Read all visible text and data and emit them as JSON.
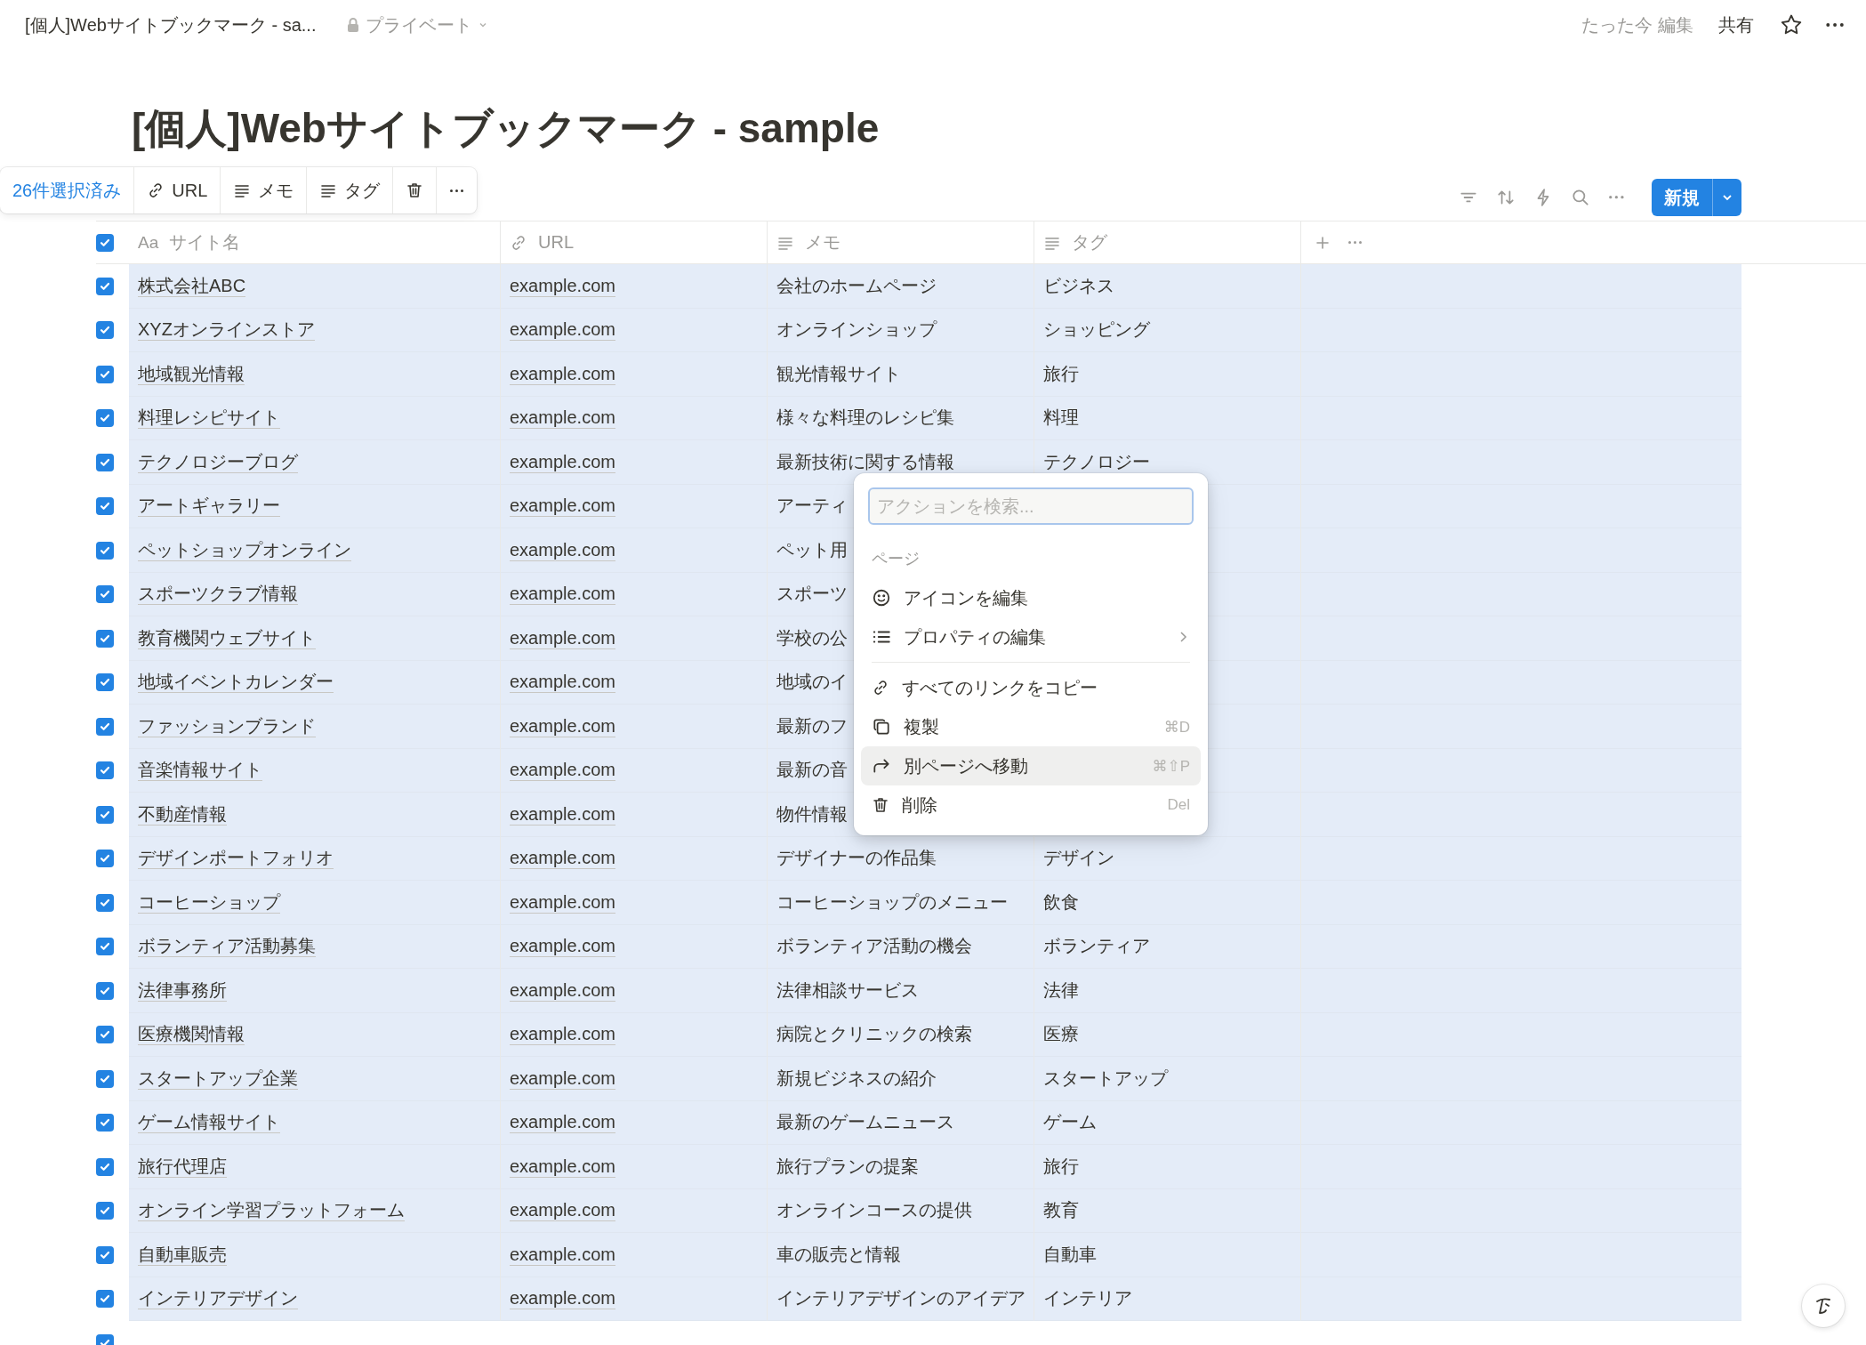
{
  "topbar": {
    "breadcrumb": "[個人]Webサイトブックマーク - sa...",
    "privacy": "プライベート",
    "edited": "たった今 編集",
    "share": "共有",
    "favorite": false
  },
  "title": "[個人]Webサイトブックマーク - sample",
  "selection_bar": {
    "count": "26件選択済み",
    "actions": [
      {
        "kind": "link",
        "label": "URL"
      },
      {
        "kind": "text",
        "label": "メモ"
      },
      {
        "kind": "text",
        "label": "タグ"
      },
      {
        "kind": "delete"
      },
      {
        "kind": "more"
      }
    ]
  },
  "new_button": "新規",
  "table": {
    "all_checked": true,
    "columns": [
      {
        "kind": "title",
        "prefix": "Aa",
        "label": "サイト名"
      },
      {
        "kind": "link",
        "label": "URL"
      },
      {
        "kind": "text",
        "label": "メモ"
      },
      {
        "kind": "text",
        "label": "タグ"
      }
    ],
    "rows": [
      {
        "checked": true,
        "name": "株式会社ABC",
        "url": "example.com",
        "memo": "会社のホームページ",
        "tag": "ビジネス"
      },
      {
        "checked": true,
        "name": "XYZオンラインストア",
        "url": "example.com",
        "memo": "オンラインショップ",
        "tag": "ショッピング"
      },
      {
        "checked": true,
        "name": "地域観光情報",
        "url": "example.com",
        "memo": "観光情報サイト",
        "tag": "旅行"
      },
      {
        "checked": true,
        "name": "料理レシピサイト",
        "url": "example.com",
        "memo": "様々な料理のレシピ集",
        "tag": "料理"
      },
      {
        "checked": true,
        "name": "テクノロジーブログ",
        "url": "example.com",
        "memo": "最新技術に関する情報",
        "tag": "テクノロジー"
      },
      {
        "checked": true,
        "name": "アートギャラリー",
        "url": "example.com",
        "memo": "アーティ"
      },
      {
        "checked": true,
        "name": "ペットショップオンライン",
        "url": "example.com",
        "memo": "ペット用"
      },
      {
        "checked": true,
        "name": "スポーツクラブ情報",
        "url": "example.com",
        "memo": "スポーツ"
      },
      {
        "checked": true,
        "name": "教育機関ウェブサイト",
        "url": "example.com",
        "memo": "学校の公"
      },
      {
        "checked": true,
        "name": "地域イベントカレンダー",
        "url": "example.com",
        "memo": "地域のイ"
      },
      {
        "checked": true,
        "name": "ファッションブランド",
        "url": "example.com",
        "memo": "最新のフ"
      },
      {
        "checked": true,
        "name": "音楽情報サイト",
        "url": "example.com",
        "memo": "最新の音"
      },
      {
        "checked": true,
        "name": "不動産情報",
        "url": "example.com",
        "memo": "物件情報"
      },
      {
        "checked": true,
        "name": "デザインポートフォリオ",
        "url": "example.com",
        "memo": "デザイナーの作品集",
        "tag": "デザイン"
      },
      {
        "checked": true,
        "name": "コーヒーショップ",
        "url": "example.com",
        "memo": "コーヒーショップのメニュー",
        "tag": "飲食"
      },
      {
        "checked": true,
        "name": "ボランティア活動募集",
        "url": "example.com",
        "memo": "ボランティア活動の機会",
        "tag": "ボランティア"
      },
      {
        "checked": true,
        "name": "法律事務所",
        "url": "example.com",
        "memo": "法律相談サービス",
        "tag": "法律"
      },
      {
        "checked": true,
        "name": "医療機関情報",
        "url": "example.com",
        "memo": "病院とクリニックの検索",
        "tag": "医療"
      },
      {
        "checked": true,
        "name": "スタートアップ企業",
        "url": "example.com",
        "memo": "新規ビジネスの紹介",
        "tag": "スタートアップ"
      },
      {
        "checked": true,
        "name": "ゲーム情報サイト",
        "url": "example.com",
        "memo": "最新のゲームニュース",
        "tag": "ゲーム"
      },
      {
        "checked": true,
        "name": "旅行代理店",
        "url": "example.com",
        "memo": "旅行プランの提案",
        "tag": "旅行"
      },
      {
        "checked": true,
        "name": "オンライン学習プラットフォーム",
        "url": "example.com",
        "memo": "オンラインコースの提供",
        "tag": "教育"
      },
      {
        "checked": true,
        "name": "自動車販売",
        "url": "example.com",
        "memo": "車の販売と情報",
        "tag": "自動車"
      },
      {
        "checked": true,
        "name": "インテリアデザイン",
        "url": "example.com",
        "memo": "インテリアデザインのアイデア",
        "tag": "インテリア"
      },
      {
        "checked": true
      }
    ]
  },
  "menu": {
    "search_placeholder": "アクションを検索...",
    "section": "ページ",
    "items": [
      {
        "kind": "smile",
        "label": "アイコンを編集",
        "submenu": false,
        "selected": false
      },
      {
        "kind": "list",
        "label": "プロパティの編集",
        "submenu": true,
        "selected": false
      },
      {
        "kind": "divider"
      },
      {
        "kind": "link",
        "label": "すべてのリンクをコピー",
        "submenu": false,
        "selected": false
      },
      {
        "kind": "copy",
        "label": "複製",
        "shortcut": "⌘D",
        "submenu": false,
        "selected": false
      },
      {
        "kind": "move",
        "label": "別ページへ移動",
        "shortcut": "⌘⇧P",
        "submenu": false,
        "selected": true
      },
      {
        "kind": "trash",
        "label": "削除",
        "shortcut": "Del",
        "submenu": false,
        "selected": false
      }
    ]
  }
}
